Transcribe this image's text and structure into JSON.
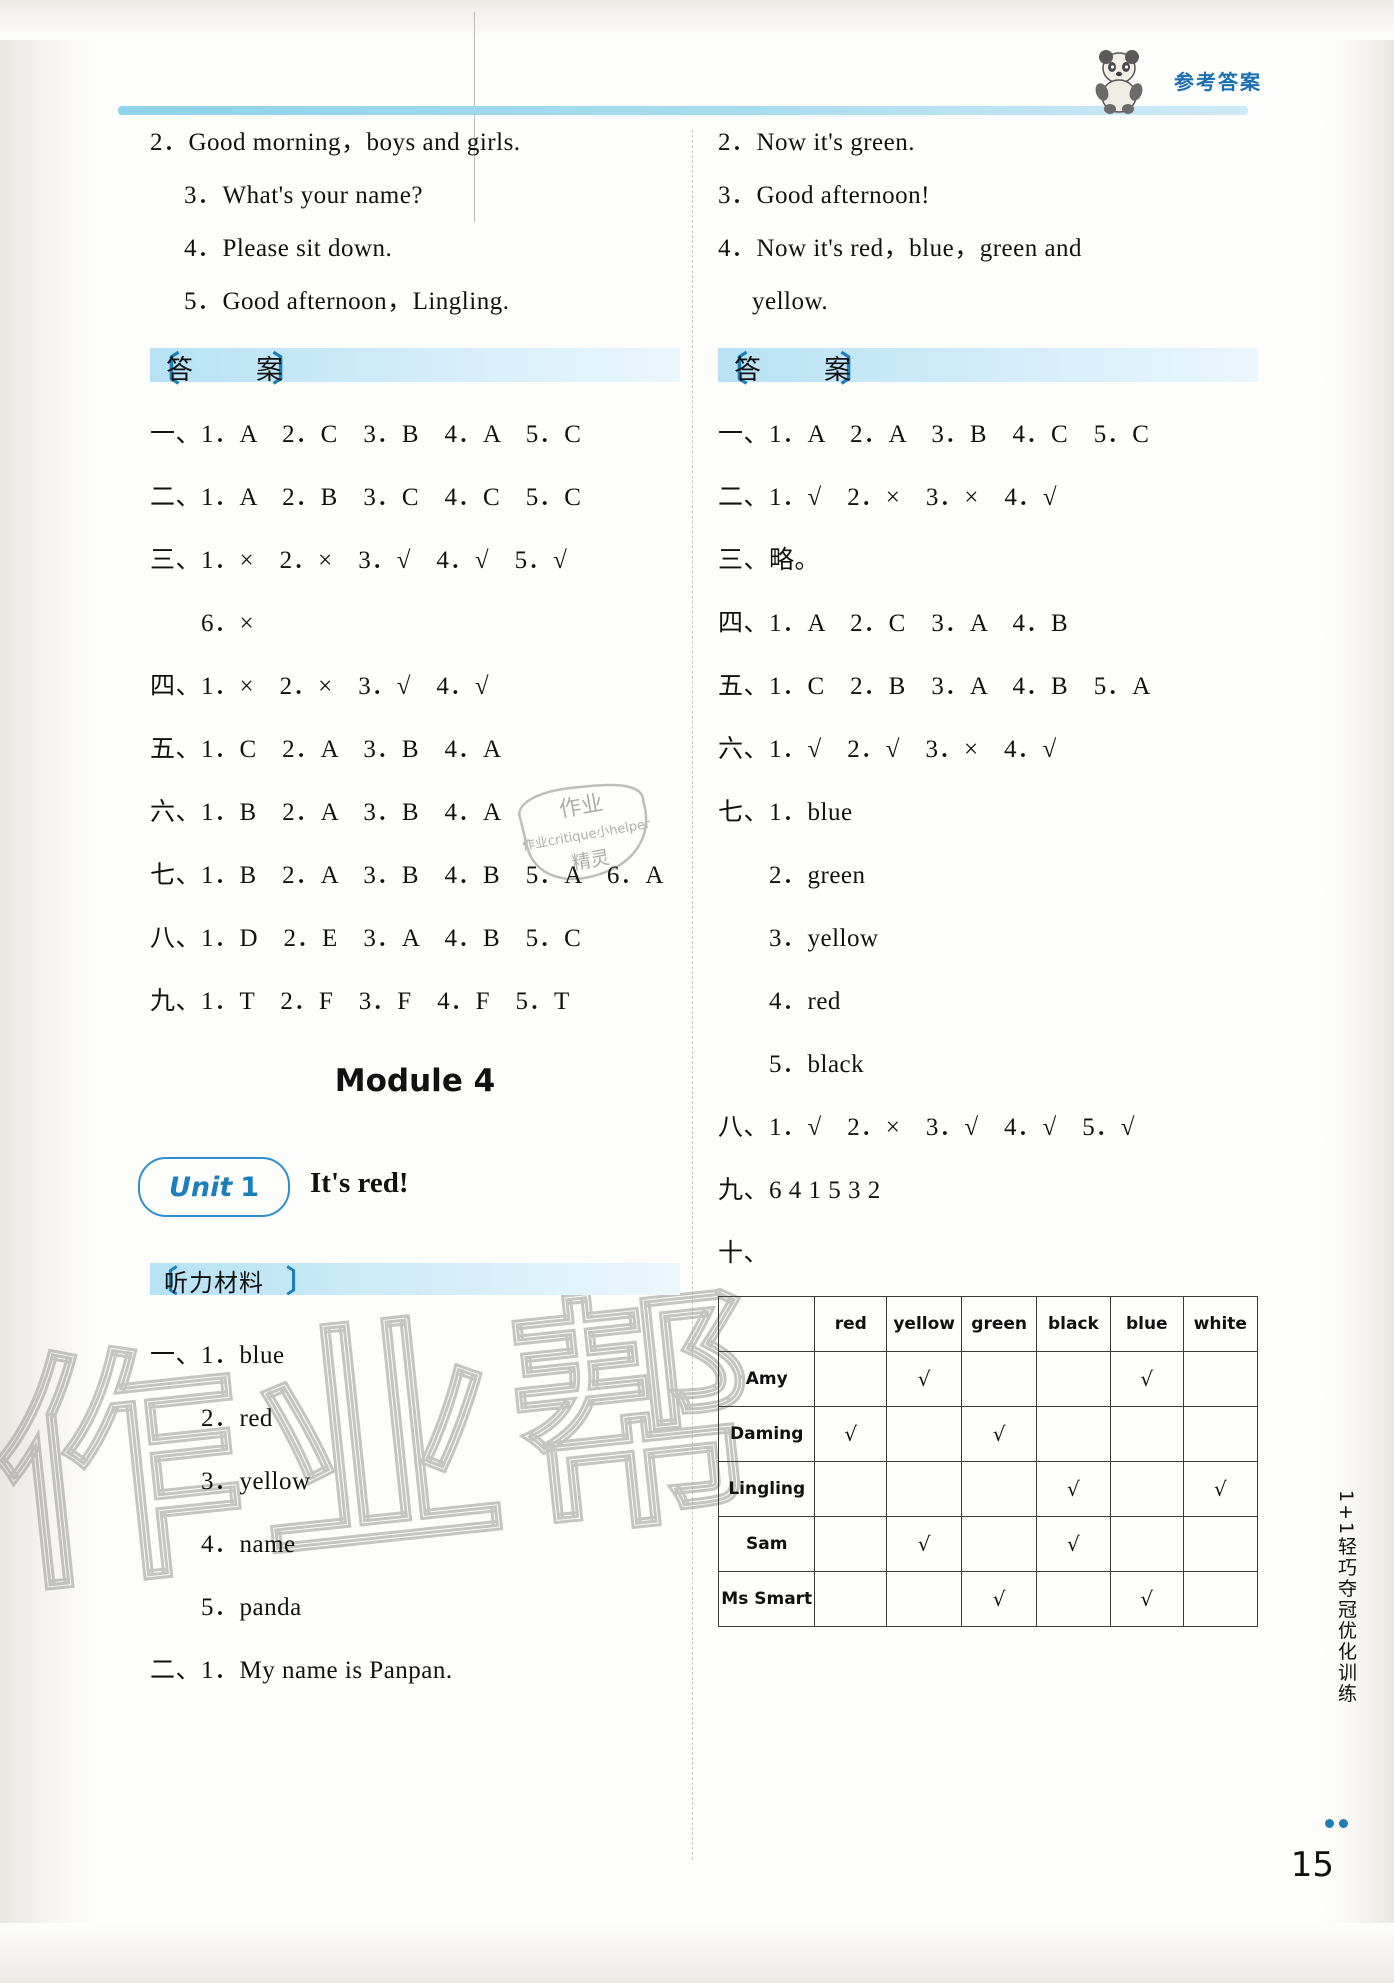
{
  "header": {
    "title": "参考答案",
    "panda_icon": "panda-icon"
  },
  "left_column": {
    "top_lines": [
      "2．Good morning，boys and girls.",
      "3．What's your name?",
      "4．Please sit down.",
      "5．Good afternoon，Lingling."
    ],
    "answer_banner": "答　案",
    "answers": [
      "一、1．A　2．C　3．B　4．A　5．C",
      "二、1．A　2．B　3．C　4．C　5．C",
      "三、1．×　2．×　3．√　4．√　5．√",
      "　　6．×",
      "四、1．×　2．×　3．√　4．√",
      "五、1．C　2．A　3．B　4．A",
      "六、1．B　2．A　3．B　4．A",
      "七、1．B　2．A　3．B　4．B　5．A　6．A",
      "八、1．D　2．E　3．A　4．B　5．C",
      "九、1．T　2．F　3．F　4．F　5．T"
    ],
    "module_title": "Module 4",
    "unit": {
      "word": "Unit",
      "number": "1",
      "name": "It's red!"
    },
    "material_banner": "听力材料",
    "material_lines": [
      "一、1．blue",
      "　　2．red",
      "　　3．yellow",
      "　　4．name",
      "　　5．panda",
      "二、1．My name is Panpan."
    ]
  },
  "right_column": {
    "top_lines": [
      "2．Now it's green.",
      "3．Good afternoon!",
      "4．Now it's red，blue，green and",
      "yellow."
    ],
    "answer_banner": "答　案",
    "answers": [
      "一、1．A　2．A　3．B　4．C　5．C",
      "二、1．√　2．×　3．×　4．√",
      "三、略。",
      "四、1．A　2．C　3．A　4．B",
      "五、1．C　2．B　3．A　4．B　5．A",
      "六、1．√　2．√　3．×　4．√",
      "七、1．blue",
      "　　2．green",
      "　　3．yellow",
      "　　4．red",
      "　　5．black",
      "八、1．√　2．×　3．√　4．√　5．√",
      "九、6 4 1 5 3 2",
      "十、"
    ],
    "table": {
      "columns": [
        "",
        "red",
        "yellow",
        "green",
        "black",
        "blue",
        "white"
      ],
      "rows": [
        {
          "name": "Amy",
          "marks": [
            "",
            "√",
            "",
            "",
            "√",
            ""
          ]
        },
        {
          "name": "Daming",
          "marks": [
            "√",
            "",
            "√",
            "",
            "",
            ""
          ]
        },
        {
          "name": "Lingling",
          "marks": [
            "",
            "",
            "",
            "√",
            "",
            "√"
          ]
        },
        {
          "name": "Sam",
          "marks": [
            "",
            "√",
            "",
            "√",
            "",
            ""
          ]
        },
        {
          "name": "Ms Smart",
          "marks": [
            "",
            "",
            "√",
            "",
            "√",
            ""
          ]
        }
      ],
      "check_mark": "√"
    }
  },
  "footer": {
    "page_number": "15",
    "spine_text": "1+1轻巧夺冠优化训练"
  },
  "watermark": {
    "text": "作业帮",
    "stamp_line1": "作业",
    "stamp_line2": "作业critique小helper",
    "stamp_line3": "精灵"
  },
  "colors": {
    "accent": "#1d7fb8",
    "banner": "#b6e2f3",
    "rule": "#8fd3ea"
  }
}
